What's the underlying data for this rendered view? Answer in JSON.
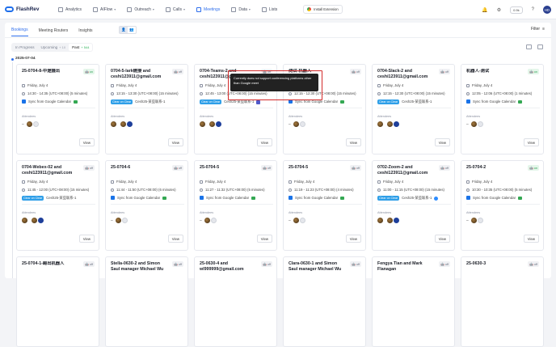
{
  "app": {
    "logo": "FlashRev",
    "nav": [
      {
        "label": "Analytics",
        "dropdown": false
      },
      {
        "label": "AIFlow",
        "dropdown": true
      },
      {
        "label": "Outreach",
        "dropdown": true
      },
      {
        "label": "Calls",
        "dropdown": true
      },
      {
        "label": "Meetings",
        "dropdown": false,
        "active": true
      },
      {
        "label": "Data",
        "dropdown": true
      },
      {
        "label": "Lists",
        "dropdown": false
      }
    ],
    "install_label": "Install Extension",
    "clock_label": "0.9k",
    "avatar_initials": "HD"
  },
  "page": {
    "tabs": [
      "Bookings",
      "Meeting Routers",
      "Insights"
    ],
    "filter_label": "Filter",
    "segments": [
      {
        "label": "In Progress",
        "count": ""
      },
      {
        "label": "Upcoming",
        "count": "+ 10"
      },
      {
        "label": "Past",
        "count": "+ 544"
      }
    ],
    "date_group": "2025-07-04",
    "tooltip": "Currently does not support conferencing platforms other than Google meet"
  },
  "cards": [
    {
      "title": "25-0704-8-中途摄出",
      "status": "on",
      "date": "Friday, July 4",
      "time": "14:30 - 14:35 (UTC+08:00) (5 minutes)",
      "chip": "",
      "location": "Sync from Google Calendar",
      "conf": "meet",
      "attendees_label": "Attendees",
      "attendees": "person",
      "view": "View"
    },
    {
      "title": "0704-5-lark链接 and ceshi123911@gmail.com",
      "status": "off",
      "date": "Friday, July 4",
      "time": "13:15 - 13:30 (UTC+08:00) (15 minutes)",
      "chip": "Clear on Clear",
      "location": "Cesh25-某些联系-1",
      "conf": "",
      "attendees_label": "Attendees",
      "attendees": "two",
      "view": "View"
    },
    {
      "title": "0704-Teams-2 and ceshi123911@gmail.com",
      "status": "off",
      "date": "Friday, July 4",
      "time": "12:45 - 13:00 (UTC+08:00) (15 minutes)",
      "chip": "Clear on Clear",
      "location": "Cesh25-某些联系-1",
      "conf": "teams",
      "attendees_label": "Attendees",
      "attendees": "two",
      "view": "View"
    },
    {
      "title": "测试-机器人",
      "status": "off",
      "date": "Friday, July 4",
      "time": "12:15 - 12:30 (UTC+08:00) (15 minutes)",
      "chip": "",
      "location": "Sync from Google Calendar",
      "conf": "meet",
      "attendees_label": "Attendees",
      "attendees": "person",
      "view": "View"
    },
    {
      "title": "0704-Slack-2 and ceshi123911@gmail.com",
      "status": "off",
      "date": "Friday, July 4",
      "time": "12:15 - 12:30 (UTC+08:00) (15 minutes)",
      "chip": "Clear on Clear",
      "location": "Cesh25-某些联系-1",
      "conf": "",
      "attendees_label": "Attendees",
      "attendees": "two",
      "view": "View"
    },
    {
      "title": "机器人-测试",
      "status": "on",
      "date": "Friday, July 4",
      "time": "12:05 - 12:06 (UTC+08:00) (1 minutes)",
      "chip": "",
      "location": "Sync from Google Calendar",
      "conf": "meet",
      "attendees_label": "Attendees",
      "attendees": "person",
      "view": "View"
    },
    {
      "title": "0704-Webex-02 and ceshi123911@gmail.com",
      "status": "off",
      "date": "Friday, July 4",
      "time": "11:45 - 12:00 (UTC+08:00) (15 minutes)",
      "chip": "Clear on Clear",
      "location": "Cesh25-某些联系-1",
      "conf": "",
      "attendees_label": "Attendees",
      "attendees": "two",
      "view": "View"
    },
    {
      "title": "25-0704-6",
      "status": "off",
      "date": "Friday, July 4",
      "time": "11:44 - 11:50 (UTC+08:00) (6 minutes)",
      "chip": "",
      "location": "Sync from Google Calendar",
      "conf": "meet",
      "attendees_label": "Attendees",
      "attendees": "person",
      "view": "View"
    },
    {
      "title": "25-0704-5",
      "status": "off",
      "date": "Friday, July 4",
      "time": "11:27 - 11:32 (UTC+08:00) (5 minutes)",
      "chip": "",
      "location": "Sync from Google Calendar",
      "conf": "meet",
      "attendees_label": "Attendees",
      "attendees": "person",
      "view": "View"
    },
    {
      "title": "25-0704-5",
      "status": "off",
      "date": "Friday, July 4",
      "time": "11:19 - 11:23 (UTC+08:00) (4 minutes)",
      "chip": "",
      "location": "Sync from Google Calendar",
      "conf": "meet",
      "attendees_label": "Attendees",
      "attendees": "person",
      "view": "View"
    },
    {
      "title": "0702-Zoom-2 and ceshi123911@gmail.com",
      "status": "off",
      "date": "Friday, July 4",
      "time": "11:00 - 11:15 (UTC+08:00) (15 minutes)",
      "chip": "Clear on Clear",
      "location": "Cesh25-某些联系-1",
      "conf": "zoom",
      "attendees_label": "Attendees",
      "attendees": "two",
      "view": "View"
    },
    {
      "title": "25-0704-2",
      "status": "on",
      "date": "Friday, July 4",
      "time": "10:30 - 10:35 (UTC+08:00) (5 minutes)",
      "chip": "",
      "location": "Sync from Google Calendar",
      "conf": "meet",
      "attendees_label": "Attendees",
      "attendees": "person",
      "view": "View"
    },
    {
      "title": "25-0704-1-踢出机器人",
      "status": "off"
    },
    {
      "title": "Stella-0630-2 and Simon Saul manager Michael Wu oe shi...",
      "status": "off"
    },
    {
      "title": "25-0630-4 and wl999999@gmail.com",
      "status": "off"
    },
    {
      "title": "Clara-0630-1 and Simon Saul manager Michael Wu oe shi...",
      "status": "off"
    },
    {
      "title": "Fengya Tian and Mark Flanagan",
      "status": "off"
    },
    {
      "title": "25-0630-3",
      "status": "off"
    }
  ]
}
